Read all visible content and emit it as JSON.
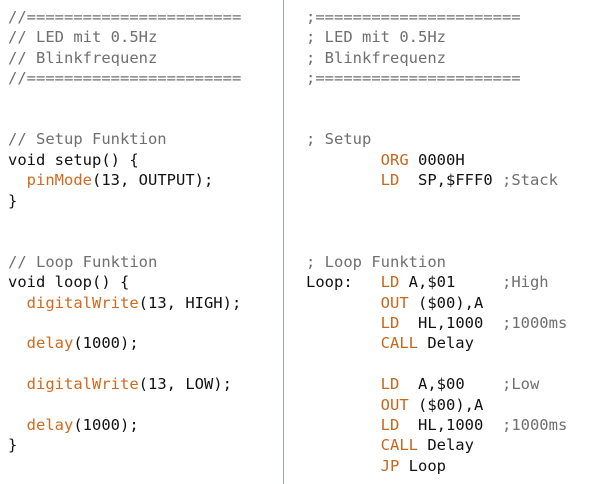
{
  "colors": {
    "comment": "#6f6f6f",
    "keyword": "#111111",
    "function": "#d2691e",
    "opcode": "#c8661c",
    "divider": "#9aa6b2",
    "background": "#ffffff"
  },
  "left": [
    {
      "parts": [
        {
          "t": "//=======================",
          "c": "cmt"
        }
      ]
    },
    {
      "parts": [
        {
          "t": "// LED mit 0.5Hz",
          "c": "cmt"
        }
      ]
    },
    {
      "parts": [
        {
          "t": "// Blinkfrequenz",
          "c": "cmt"
        }
      ]
    },
    {
      "parts": [
        {
          "t": "//=======================",
          "c": "cmt"
        }
      ]
    },
    {
      "parts": []
    },
    {
      "parts": []
    },
    {
      "parts": [
        {
          "t": "// Setup Funktion",
          "c": "cmt"
        }
      ]
    },
    {
      "parts": [
        {
          "t": "void",
          "c": "kw"
        },
        {
          "t": " setup() {",
          "c": "tx"
        }
      ]
    },
    {
      "parts": [
        {
          "t": "  ",
          "c": "tx"
        },
        {
          "t": "pinMode",
          "c": "fn"
        },
        {
          "t": "(13, OUTPUT);",
          "c": "tx"
        }
      ]
    },
    {
      "parts": [
        {
          "t": "}",
          "c": "tx"
        }
      ]
    },
    {
      "parts": []
    },
    {
      "parts": []
    },
    {
      "parts": [
        {
          "t": "// Loop Funktion",
          "c": "cmt"
        }
      ]
    },
    {
      "parts": [
        {
          "t": "void",
          "c": "kw"
        },
        {
          "t": " loop() {",
          "c": "tx"
        }
      ]
    },
    {
      "parts": [
        {
          "t": "  ",
          "c": "tx"
        },
        {
          "t": "digitalWrite",
          "c": "fn"
        },
        {
          "t": "(13, HIGH);",
          "c": "tx"
        }
      ]
    },
    {
      "parts": []
    },
    {
      "parts": [
        {
          "t": "  ",
          "c": "tx"
        },
        {
          "t": "delay",
          "c": "fn"
        },
        {
          "t": "(1000);",
          "c": "tx"
        }
      ]
    },
    {
      "parts": []
    },
    {
      "parts": [
        {
          "t": "  ",
          "c": "tx"
        },
        {
          "t": "digitalWrite",
          "c": "fn"
        },
        {
          "t": "(13, LOW);",
          "c": "tx"
        }
      ]
    },
    {
      "parts": []
    },
    {
      "parts": [
        {
          "t": "  ",
          "c": "tx"
        },
        {
          "t": "delay",
          "c": "fn"
        },
        {
          "t": "(1000);",
          "c": "tx"
        }
      ]
    },
    {
      "parts": [
        {
          "t": "}",
          "c": "tx"
        }
      ]
    }
  ],
  "right": [
    {
      "parts": [
        {
          "t": ";======================",
          "c": "cmt"
        }
      ]
    },
    {
      "parts": [
        {
          "t": "; LED mit 0.5Hz",
          "c": "cmt"
        }
      ]
    },
    {
      "parts": [
        {
          "t": "; Blinkfrequenz",
          "c": "cmt"
        }
      ]
    },
    {
      "parts": [
        {
          "t": ";======================",
          "c": "cmt"
        }
      ]
    },
    {
      "parts": []
    },
    {
      "parts": []
    },
    {
      "parts": [
        {
          "t": "; Setup",
          "c": "cmt"
        }
      ]
    },
    {
      "parts": [
        {
          "t": "        ",
          "c": "tx"
        },
        {
          "t": "ORG",
          "c": "op"
        },
        {
          "t": " 0000H",
          "c": "tx"
        }
      ]
    },
    {
      "parts": [
        {
          "t": "        ",
          "c": "tx"
        },
        {
          "t": "LD",
          "c": "op"
        },
        {
          "t": "  SP,$FFF0 ",
          "c": "tx"
        },
        {
          "t": ";Stack",
          "c": "cmt"
        }
      ]
    },
    {
      "parts": []
    },
    {
      "parts": []
    },
    {
      "parts": []
    },
    {
      "parts": [
        {
          "t": "; Loop Funktion",
          "c": "cmt"
        }
      ]
    },
    {
      "parts": [
        {
          "t": "Loop:   ",
          "c": "tx"
        },
        {
          "t": "LD",
          "c": "op"
        },
        {
          "t": " A,$01     ",
          "c": "tx"
        },
        {
          "t": ";High",
          "c": "cmt"
        }
      ]
    },
    {
      "parts": [
        {
          "t": "        ",
          "c": "tx"
        },
        {
          "t": "OUT",
          "c": "op"
        },
        {
          "t": " ($00),A",
          "c": "tx"
        }
      ]
    },
    {
      "parts": [
        {
          "t": "        ",
          "c": "tx"
        },
        {
          "t": "LD",
          "c": "op"
        },
        {
          "t": "  HL,1000  ",
          "c": "tx"
        },
        {
          "t": ";1000ms",
          "c": "cmt"
        }
      ]
    },
    {
      "parts": [
        {
          "t": "        ",
          "c": "tx"
        },
        {
          "t": "CALL",
          "c": "op"
        },
        {
          "t": " Delay",
          "c": "tx"
        }
      ]
    },
    {
      "parts": []
    },
    {
      "parts": [
        {
          "t": "        ",
          "c": "tx"
        },
        {
          "t": "LD",
          "c": "op"
        },
        {
          "t": "  A,$00    ",
          "c": "tx"
        },
        {
          "t": ";Low",
          "c": "cmt"
        }
      ]
    },
    {
      "parts": [
        {
          "t": "        ",
          "c": "tx"
        },
        {
          "t": "OUT",
          "c": "op"
        },
        {
          "t": " ($00),A",
          "c": "tx"
        }
      ]
    },
    {
      "parts": [
        {
          "t": "        ",
          "c": "tx"
        },
        {
          "t": "LD",
          "c": "op"
        },
        {
          "t": "  HL,1000  ",
          "c": "tx"
        },
        {
          "t": ";1000ms",
          "c": "cmt"
        }
      ]
    },
    {
      "parts": [
        {
          "t": "        ",
          "c": "tx"
        },
        {
          "t": "CALL",
          "c": "op"
        },
        {
          "t": " Delay",
          "c": "tx"
        }
      ]
    },
    {
      "parts": [
        {
          "t": "        ",
          "c": "tx"
        },
        {
          "t": "JP",
          "c": "op"
        },
        {
          "t": " Loop",
          "c": "tx"
        }
      ]
    }
  ]
}
